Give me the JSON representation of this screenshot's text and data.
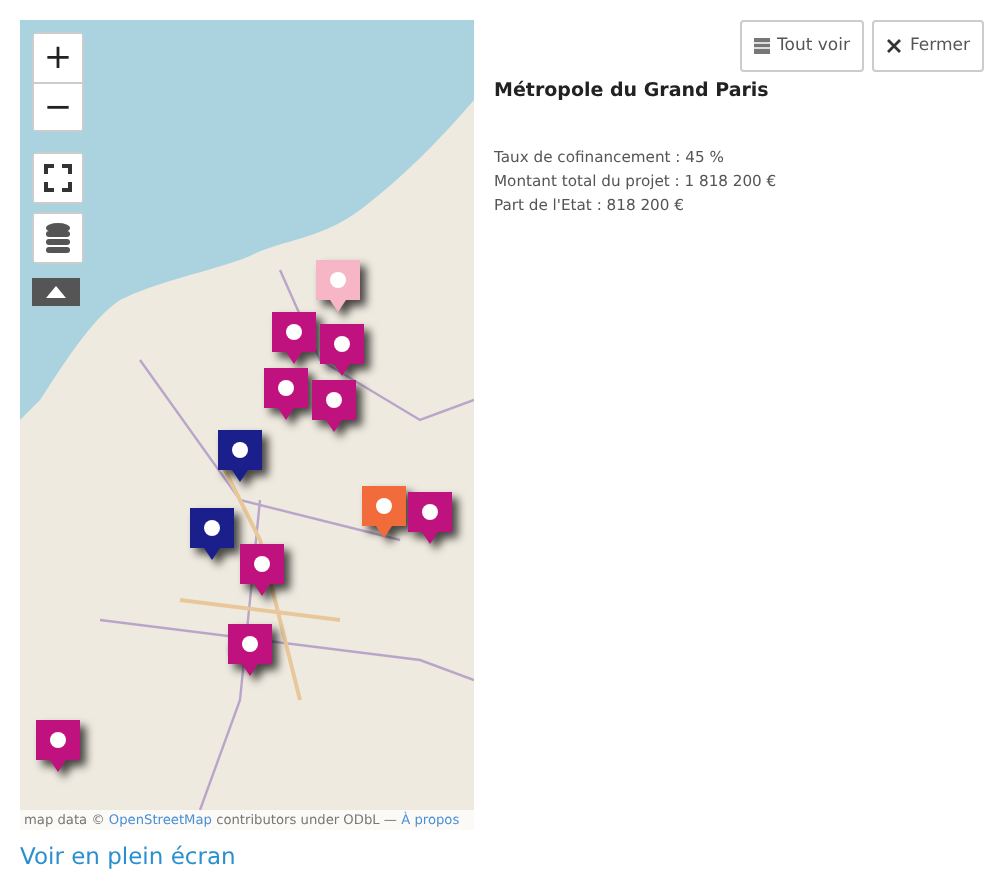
{
  "map": {
    "controls": {
      "zoom_in": "+",
      "zoom_out": "−"
    },
    "markers": [
      {
        "color": "#f7b6c6"
      },
      {
        "color": "#c0127f"
      },
      {
        "color": "#c0127f"
      },
      {
        "color": "#c0127f"
      },
      {
        "color": "#c0127f"
      },
      {
        "color": "#1a1f8c"
      },
      {
        "color": "#1a1f8c"
      },
      {
        "color": "#f26b3a"
      },
      {
        "color": "#c0127f"
      },
      {
        "color": "#c0127f"
      },
      {
        "color": "#c0127f"
      },
      {
        "color": "#c0127f"
      }
    ],
    "attribution": {
      "prefix": "map data ©",
      "link": "OpenStreetMap",
      "middle": "contributors under ODbL —",
      "about": "À propos"
    }
  },
  "fullscreen_link": "Voir en plein écran",
  "panel": {
    "buttons": [
      "Tout voir",
      "Fermer"
    ],
    "title": "Métropole du Grand Paris",
    "lines": [
      "Taux de cofinancement : 45 %",
      "Montant total du projet : 1 818 200 €",
      "Part de l'Etat : 818 200 €"
    ]
  }
}
